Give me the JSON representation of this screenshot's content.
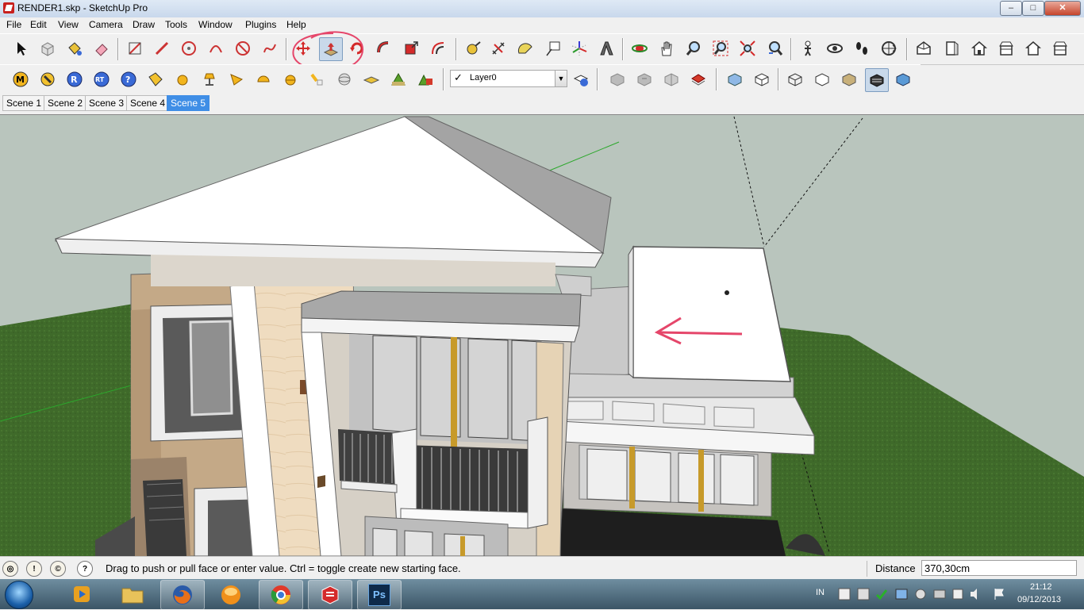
{
  "window": {
    "title": "RENDER1.skp - SketchUp Pro",
    "min": "–",
    "max": "□",
    "close": "✕"
  },
  "menu": [
    "File",
    "Edit",
    "View",
    "Camera",
    "Draw",
    "Tools",
    "Window",
    "Plugins",
    "Help"
  ],
  "toolbar1": [
    "select-icon",
    "component-icon",
    "paint-bucket-icon",
    "eraser-icon",
    "rectangle-icon",
    "line-icon",
    "circle-icon",
    "arc-icon",
    "polygon-icon",
    "freehand-icon",
    "move-icon",
    "push-pull-icon",
    "rotate-icon",
    "follow-me-icon",
    "scale-icon",
    "offset-icon",
    "tape-measure-icon",
    "dimension-icon",
    "protractor-icon",
    "text-icon",
    "axes-icon",
    "3d-text-icon",
    "orbit-icon",
    "pan-icon",
    "zoom-icon",
    "zoom-window-icon",
    "zoom-extents-icon",
    "previous-view-icon",
    "position-camera-icon",
    "look-around-icon",
    "walk-icon",
    "section-plane-icon",
    "iso-view-icon",
    "top-view-icon",
    "front-view-icon",
    "right-view-icon",
    "back-view-icon",
    "left-view-icon"
  ],
  "toolbar2": [
    "vray-materials-icon",
    "vray-options-icon",
    "vray-render-icon",
    "vray-rt-icon",
    "vray-help-icon",
    "vray-tag-icon",
    "omni-light-icon",
    "spot-light-icon",
    "rect-light-icon",
    "sphere-light-icon",
    "dome-light-icon",
    "ies-light-icon",
    "vray-sphere-icon",
    "vray-plane-icon",
    "vray-proxy-icon",
    "vray-fur-icon"
  ],
  "layers": {
    "current": "Layer0",
    "check": "✓",
    "drop": "▼"
  },
  "toolbar2_right": [
    "layer-manager-icon",
    "shadows-icon",
    "fog-icon",
    "styles-icon",
    "sandbox-icon",
    "xray-icon",
    "back-edges-icon",
    "wireframe-icon",
    "hidden-line-icon",
    "shaded-icon",
    "shaded-textures-icon",
    "monochrome-icon"
  ],
  "scenes": [
    "Scene 1",
    "Scene 2",
    "Scene 3",
    "Scene 4",
    "Scene 5"
  ],
  "active_scene": "Scene 5",
  "status": {
    "message": "Drag to push or pull face or enter value.  Ctrl = toggle create new starting face.",
    "vcb_label": "Distance",
    "vcb_value": "370,30cm",
    "help_glyph": "?"
  },
  "taskbar": {
    "apps": [
      "media-player",
      "windows-explorer",
      "firefox",
      "orange-app",
      "chrome",
      "sketchup",
      "photoshop"
    ],
    "ps_label": "Ps",
    "lang": "IN",
    "time": "21:12",
    "date": "09/12/2013"
  },
  "colors": {
    "active_scene": "#3f8ee6",
    "grass": "#3e6b2a",
    "sky": "#b9c5bd",
    "annotation": "#e5466a"
  }
}
